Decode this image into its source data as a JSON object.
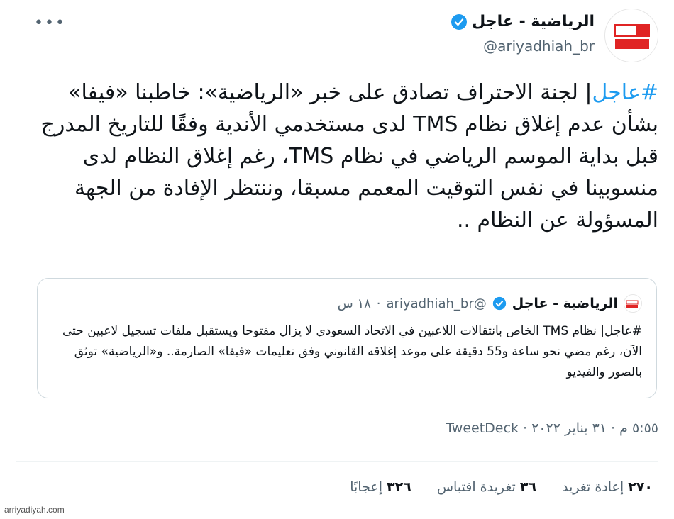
{
  "author": {
    "display_name": "الرياضية - عاجل",
    "handle": "@ariyadhiah_br",
    "verified": true,
    "avatar_badge_text": "عاجل",
    "avatar_sub_text": "الرياضية"
  },
  "tweet": {
    "hashtag": "#عاجل",
    "text": "| لجنة الاحتراف تصادق على خبر «الرياضية»: خاطبنا «فيفا» بشأن عدم إغلاق نظام TMS لدى مستخدمي الأندية وفقًا للتاريخ المدرج قبل بداية الموسم الرياضي في نظام TMS، رغم إغلاق النظام لدى منسوبينا في نفس التوقيت المعمم مسبقا، وننتظر الإفادة من الجهة المسؤولة عن النظام .."
  },
  "quoted_tweet": {
    "display_name": "الرياضية - عاجل",
    "handle": "@ariyadhiah_br",
    "time": "١٨ س",
    "hashtag": "#عاجل",
    "text": "| نظام TMS الخاص بانتقالات اللاعبين في الاتحاد السعودي لا يزال مفتوحا ويستقبل ملفات تسجيل لاعبين حتى الآن، رغم مضي نحو ساعة و55 دقيقة على موعد إغلاقه القانوني وفق تعليمات «فيفا» الصارمة.. و«الرياضية» توثق بالصور والفيديو"
  },
  "meta": {
    "time": "٥:٥٥ م",
    "date": "٣١ يناير ٢٠٢٢",
    "source": "TweetDeck"
  },
  "stats": {
    "retweets_count": "٢٧٠",
    "retweets_label": "إعادة تغريد",
    "quotes_count": "٣٦",
    "quotes_label": "تغريدة اقتباس",
    "likes_count": "٣٢٦",
    "likes_label": "إعجابًا"
  },
  "watermark": "arriyadiyah.com",
  "colors": {
    "brand_red": "#e02424",
    "link_blue": "#1d9bf0",
    "verified_blue": "#1d9bf0",
    "secondary_text": "#536471"
  },
  "icons": {
    "more": "more-dots-icon",
    "verified": "verified-badge-icon"
  }
}
